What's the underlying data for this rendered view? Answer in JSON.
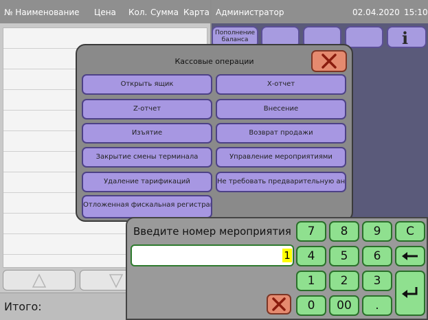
{
  "receipt": {
    "columns": {
      "name": "№ Наименование",
      "price": "Цена",
      "qty": "Кол.",
      "sum": "Сумма",
      "card": "Карта"
    },
    "total_label": "Итого:"
  },
  "header": {
    "user": "Администратор",
    "date": "02.04.2020",
    "time": "15:10"
  },
  "top_buttons": {
    "top_up_label": "Пополнение баланса"
  },
  "cash_operations": {
    "title": "Кассовые операции",
    "buttons": [
      "Открыть ящик",
      "Х-отчет",
      "Z-отчет",
      "Внесение",
      "Изъятие",
      "Возврат продажи",
      "Закрытие смены терминала",
      "Управление мероприятиями",
      "Удаление тарификаций",
      "Не требовать предварительную анкету",
      "Отложенная фискальная регистрация"
    ]
  },
  "keypad": {
    "prompt": "Введите номер мероприятия",
    "input_value": "1",
    "keys": [
      "7",
      "8",
      "9",
      "C",
      "4",
      "5",
      "6",
      "1",
      "2",
      "3",
      "0",
      "00",
      "."
    ]
  },
  "colors": {
    "dialog_button": "#a797e2",
    "keypad_key": "#8fe08f",
    "close_button": "#e58a6f",
    "input_highlight": "#ffff00"
  }
}
